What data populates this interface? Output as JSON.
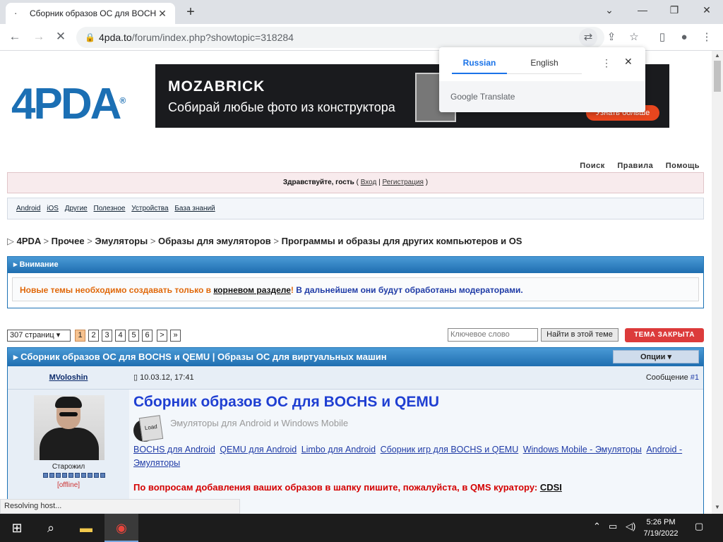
{
  "browser": {
    "tab_title": "Сборник образов ОС для BOCHS",
    "tab_favicon": "loading-icon",
    "new_tab": "+",
    "url_host": "4pda.to",
    "url_path": "/forum/index.php?showtopic=318284",
    "status": "Resolving host..."
  },
  "translate_popup": {
    "tab_source": "Russian",
    "tab_target": "English",
    "footer": "Google Translate"
  },
  "site": {
    "logo": "4PDA",
    "logo_mark": "®",
    "top_links": [
      "Поиск",
      "Правила",
      "Помощь"
    ],
    "greeting": "Здравствуйте, гость",
    "login": "Вход",
    "register": "Регистрация",
    "nav": [
      "Android",
      "iOS",
      "Другие",
      "Полезное",
      "Устройства",
      "База знаний"
    ]
  },
  "banner": {
    "brand": "MOZABRICK",
    "slogan": "Собирай любые фото из конструктора",
    "cta": "Узнать больше"
  },
  "breadcrumbs": [
    "4PDA",
    "Прочее",
    "Эмуляторы",
    "Образы для эмуляторов",
    "Программы и образы для других компьютеров и OS"
  ],
  "notice": {
    "header": "Внимание",
    "text_before": "Новые темы необходимо создавать только в ",
    "link": "корневом разделе",
    "text_mid": "! ",
    "text_after": "В дальнейшем они будут обработаны модераторами."
  },
  "pagination": {
    "pages_label": "307 страниц",
    "pages": [
      "1",
      "2",
      "3",
      "4",
      "5",
      "6",
      ">",
      "»"
    ],
    "search_placeholder": "Ключевое слово",
    "search_button": "Найти в этой теме",
    "closed_button": "ТЕМА ЗАКРЫТА"
  },
  "topic": {
    "title": "Сборник образов ОС для BOCHS и QEMU | Образы ОС для виртуальных машин",
    "options": "Опции ▾"
  },
  "post": {
    "author": "MVoloshin",
    "date": "10.03.12, 17:41",
    "number_label": "Сообщение ",
    "number": "#1",
    "rank": "Старожил",
    "status": "[offline]",
    "title": "Сборник образов ОС для BOCHS и QEMU",
    "subtitle": "Эмуляторы для Android и Windows Mobile",
    "icon_label": "Load",
    "links": [
      "BOCHS для Android",
      "QEMU для Android",
      "Limbo для Android",
      "Сборник игр для BOCHS и QEMU",
      "Windows Mobile - Эмуляторы",
      "Android - Эмуляторы"
    ],
    "red_text": "По вопросам добавления ваших образов в шапку пишите, пожалуйста, в QMS куратору: ",
    "red_link": "CDSI"
  },
  "taskbar": {
    "time": "5:26 PM",
    "date": "7/19/2022"
  }
}
